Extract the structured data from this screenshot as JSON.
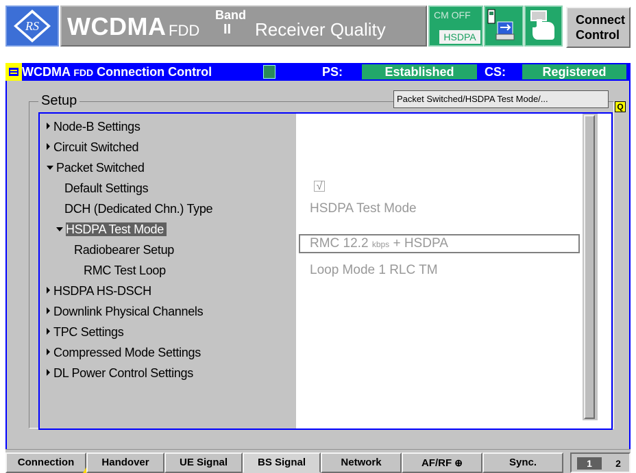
{
  "header": {
    "app_name": "WCDMA",
    "app_suffix": "FDD",
    "band_label": "Band",
    "band_value": "II",
    "measurement": "Receiver Quality",
    "cm_status": "CM OFF",
    "hsdpa_badge": "HSDPA",
    "connect_button": "Connect Control"
  },
  "status_bar": {
    "title_main": "WCDMA",
    "title_fdd": "FDD",
    "title_rest": "Connection Control",
    "ps_label": "PS:",
    "ps_value": "Established",
    "cs_label": "CS:",
    "cs_value": "Registered"
  },
  "setup": {
    "title": "Setup",
    "path": "Packet Switched/HSDPA Test Mode/...",
    "tree": [
      {
        "label": "Node-B Settings"
      },
      {
        "label": "Circuit Switched"
      },
      {
        "label": "Packet Switched"
      },
      {
        "label": "Default Settings"
      },
      {
        "label": "DCH (Dedicated Chn.) Type"
      },
      {
        "label": "HSDPA Test Mode"
      },
      {
        "label": "Radiobearer Setup"
      },
      {
        "label": "RMC Test Loop"
      },
      {
        "label": "HSDPA HS-DSCH"
      },
      {
        "label": "Downlink Physical Channels"
      },
      {
        "label": "TPC Settings"
      },
      {
        "label": "Compressed Mode Settings"
      },
      {
        "label": "DL Power Control Settings"
      }
    ],
    "values": {
      "checkbox": "√",
      "dch_type": "HSDPA Test Mode",
      "rmc_main": "RMC 12.2",
      "rmc_unit": "kbps",
      "rmc_rest": "+ HSDPA",
      "loop_mode": "Loop Mode 1 RLC TM"
    }
  },
  "tabs": [
    "Connection",
    "Handover",
    "UE Signal",
    "BS Signal",
    "Network",
    "AF/RF",
    "Sync."
  ],
  "pages": {
    "current": "1",
    "other": "2"
  },
  "colors": {
    "accent_blue": "#0000ff",
    "status_green": "#22a86a",
    "highlight_yellow": "#ffff00"
  }
}
